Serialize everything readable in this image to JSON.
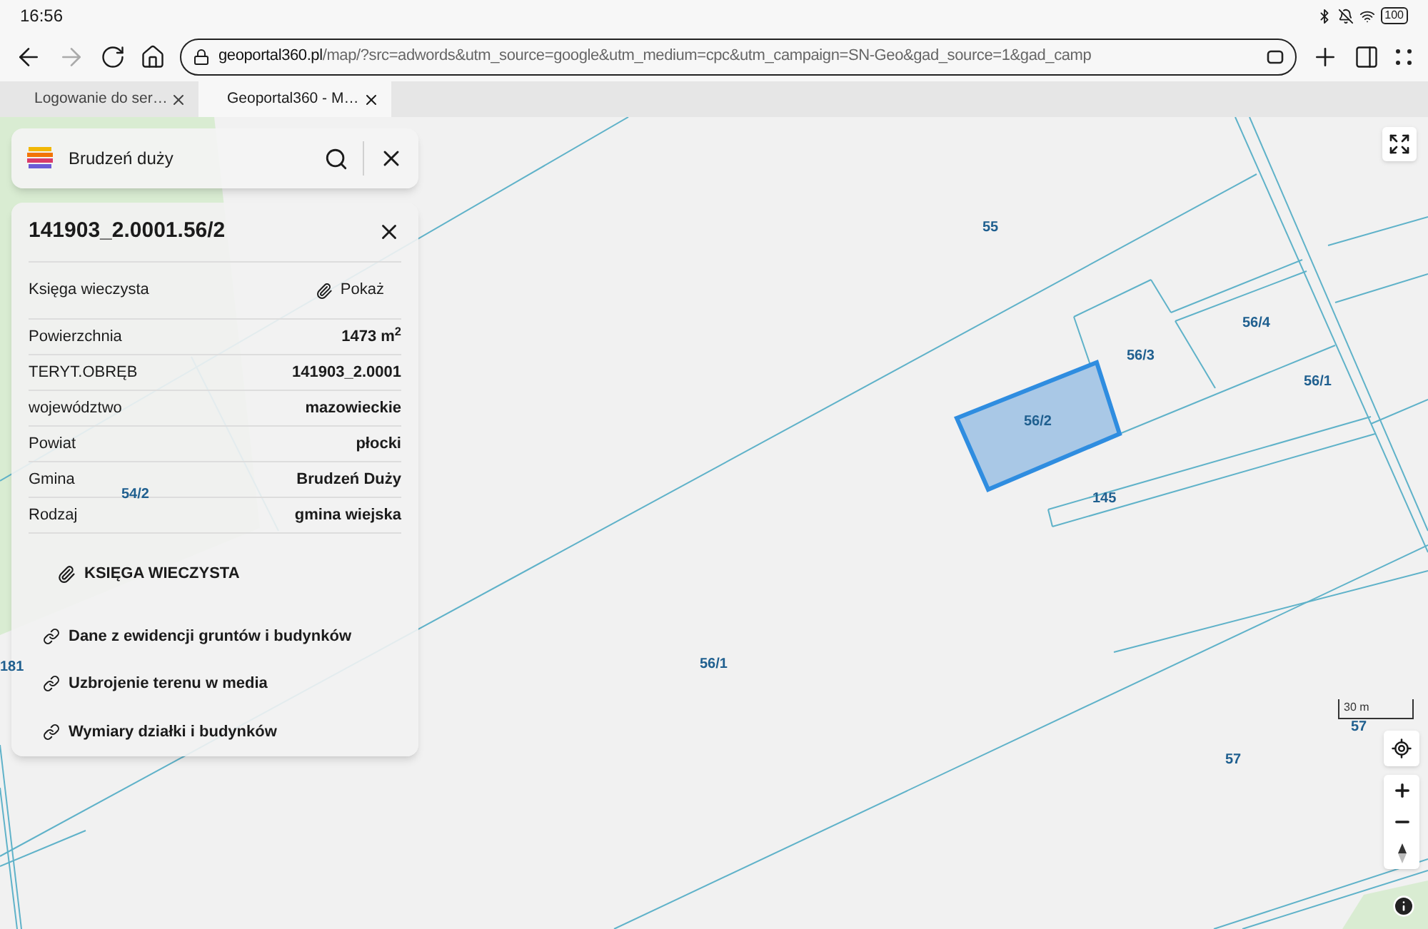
{
  "status_bar": {
    "time": "16:56",
    "battery": "100"
  },
  "browser": {
    "url_host": "geoportal360.pl",
    "url_path": "/map/?src=adwords&utm_source=google&utm_medium=cpc&utm_campaign=SN-Geo&gad_source=1&gad_camp",
    "forward_disabled": true
  },
  "tabs": [
    {
      "label": "Logowanie do ser…",
      "selected": false
    },
    {
      "label": "Geoportal360 - M…",
      "selected": true
    }
  ],
  "search": {
    "value": "Brudzeń duży"
  },
  "parcel_panel": {
    "title": "141903_2.0001.56/2",
    "rows": [
      {
        "label": "Księga wieczysta",
        "value": "Pokaż",
        "kind": "link"
      },
      {
        "label": "Powierzchnia",
        "value": "1473 m$^{2}$",
        "kind": "text"
      },
      {
        "label": "TERYT.OBRĘB",
        "value": "141903_2.0001",
        "kind": "text"
      },
      {
        "label": "województwo",
        "value": "mazowieckie",
        "kind": "text"
      },
      {
        "label": "Powiat",
        "value": "płocki",
        "kind": "text"
      },
      {
        "label": "Gmina",
        "value": "Brudzeń Duży",
        "kind": "text"
      },
      {
        "label": "Rodzaj",
        "value": "gmina wiejska",
        "kind": "text"
      }
    ],
    "sections": [
      {
        "label": "KSIĘGA WIECZYSTA",
        "kind": "attachment"
      },
      {
        "label": "Dane z ewidencji gruntów i budynków",
        "kind": "link"
      },
      {
        "label": "Uzbrojenie terenu w media",
        "kind": "link"
      },
      {
        "label": "Wymiary działki i budynków",
        "kind": "link"
      }
    ]
  },
  "map": {
    "labels": [
      {
        "text": "55"
      },
      {
        "text": "56/3"
      },
      {
        "text": "56/4"
      },
      {
        "text": "56/1"
      },
      {
        "text": "56/2"
      },
      {
        "text": "145"
      },
      {
        "text": "54/2"
      },
      {
        "text": "56/1"
      },
      {
        "text": "57"
      },
      {
        "text": "57"
      },
      {
        "text": "181"
      }
    ],
    "scale": "30 m"
  }
}
